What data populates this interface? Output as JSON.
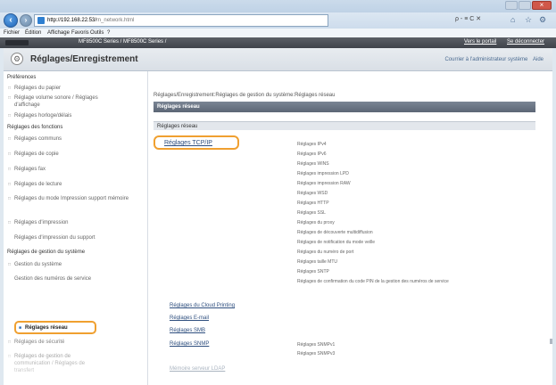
{
  "browser": {
    "url_host": "http://192.168.22.53/",
    "url_path": "m_network.html",
    "address_tools": "ρ - ≡ C ✕",
    "menu": [
      "Fichier",
      "Édition",
      "Affichage",
      "Favoris",
      "Outils",
      "?"
    ],
    "tab_title": "MF8500C Series / MF8500C Series /",
    "tab_links": [
      "Vers le portail",
      "Se déconnecter"
    ]
  },
  "header": {
    "title": "Réglages/Enregistrement",
    "links": [
      "Courrier à l'administrateur système",
      "Aide"
    ]
  },
  "sidebar": {
    "sections": [
      {
        "title": "Préférences",
        "items": [
          "Réglages du papier",
          "Réglage volume sonore / Réglages d'affichage",
          "Réglages horloge/délais"
        ]
      },
      {
        "title": "Réglages des fonctions",
        "items": [
          "Réglages communs",
          "Réglages de copie",
          "Réglages fax",
          "Réglages de lecture",
          "Réglages du mode Impression support mémoire",
          "Réglages d'impression",
          "Réglages d'impression du support"
        ]
      },
      {
        "title": "Réglages de gestion du système",
        "items": [
          "Gestion du système",
          "Gestion des numéros de service"
        ]
      }
    ],
    "active_item": "Réglages réseau",
    "after_items": [
      "Réglages de sécurité",
      "Réglages de gestion de communication / Réglages de transfert"
    ]
  },
  "main": {
    "breadcrumb": "Réglages/Enregistrement:Réglages de gestion du système:Réglages réseau",
    "section_title": "Réglages réseau",
    "subsection_title": "Réglages réseau",
    "tcp_link": "Réglages TCP/IP",
    "tcp_items": [
      "Réglages IPv4",
      "Réglages IPv6",
      "Réglages WINS",
      "Réglages impression LPD",
      "Réglages impression RAW",
      "Réglages WSD",
      "Réglages HTTP",
      "Réglages SSL",
      "Réglages du proxy",
      "Réglages de découverte multidiffusion",
      "Réglages de notification du mode veille",
      "Réglages du numéro de port",
      "Réglages taille MTU",
      "Réglages SNTP",
      "Réglages de confirmation du code PIN de la gestion des numéros de service"
    ],
    "links": [
      "Réglages du Cloud Printing",
      "Réglages E-mail",
      "Réglages SMB",
      "Réglages SNMP"
    ],
    "snmp_items": [
      "Réglages SNMPv1",
      "Réglages SNMPv3"
    ],
    "faded_link": "Mémoire serveur LDAP"
  }
}
